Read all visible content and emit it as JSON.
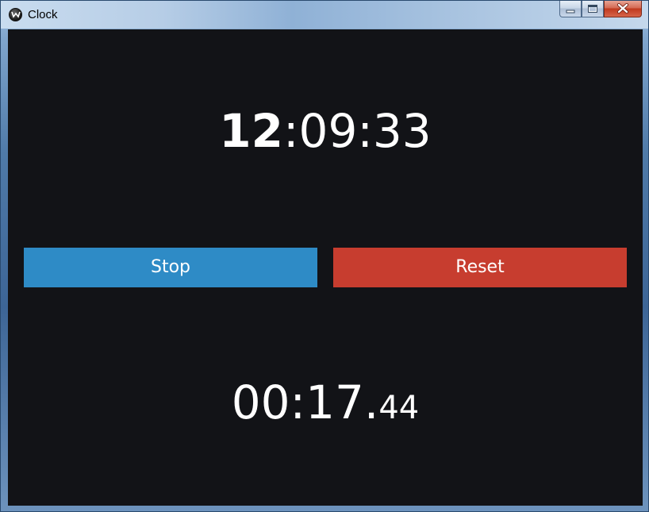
{
  "window": {
    "title": "Clock",
    "minimize_icon": "minimize-icon",
    "maximize_icon": "maximize-icon",
    "close_icon": "close-icon",
    "background_color": "#121317"
  },
  "clock": {
    "hours": "12",
    "rest": ":09:33"
  },
  "buttons": {
    "stop_label": "Stop",
    "stop_color": "#2e8bc6",
    "reset_label": "Reset",
    "reset_color": "#c73d2f"
  },
  "stopwatch": {
    "main": "00:17.",
    "fraction": "44"
  }
}
